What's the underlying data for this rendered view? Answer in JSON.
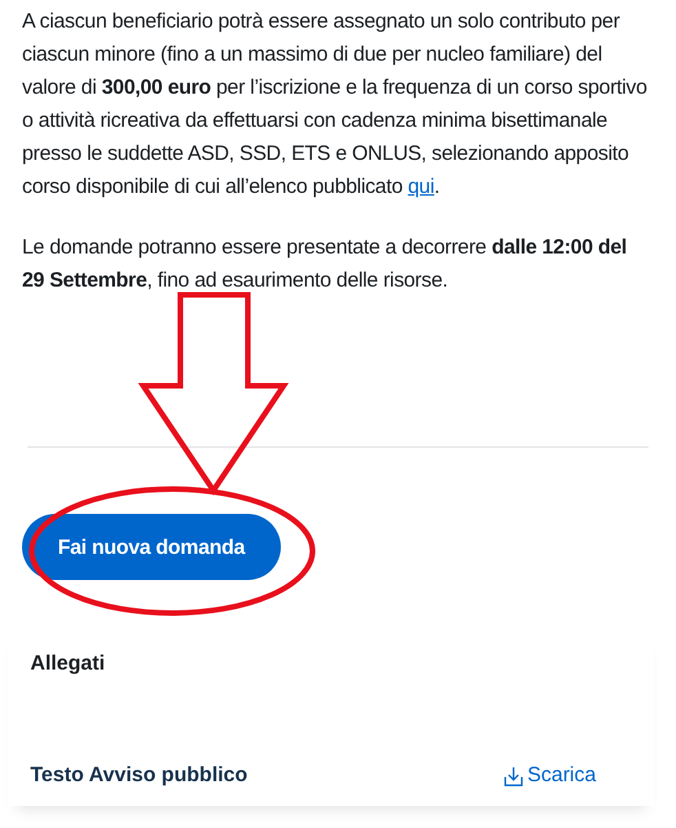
{
  "paragraphs": [
    {
      "text": "A ciascun beneficiario potrà essere assegnato un solo contributo per ciascun minore (fino a un massimo di due per nucleo familiare) del valore di **300,00 euro** per l’iscrizione e la frequenza di un corso sportivo o attività ricreativa da effettuarsi con cadenza minima bisettimanale presso le suddette ASD, SSD, ETS e ONLUS, selezionando apposito corso disponibile di cui all’elenco pubblicato",
      "link": "qui",
      "after": "."
    },
    {
      "text": "Le domande potranno essere presentate a decorrere **dalle 12:00 del 29 Settembre**, fino ad esaurimento delle risorse."
    }
  ],
  "primary_button": "Fai nuova domanda",
  "attachments": {
    "title": "Allegati",
    "items": [
      {
        "name": "Testo Avviso pubblico",
        "action": "Scarica"
      }
    ]
  },
  "arrow_annotation": {
    "color": "#e8101c"
  },
  "ellipse_annotation": {
    "color": "#e8101c"
  }
}
